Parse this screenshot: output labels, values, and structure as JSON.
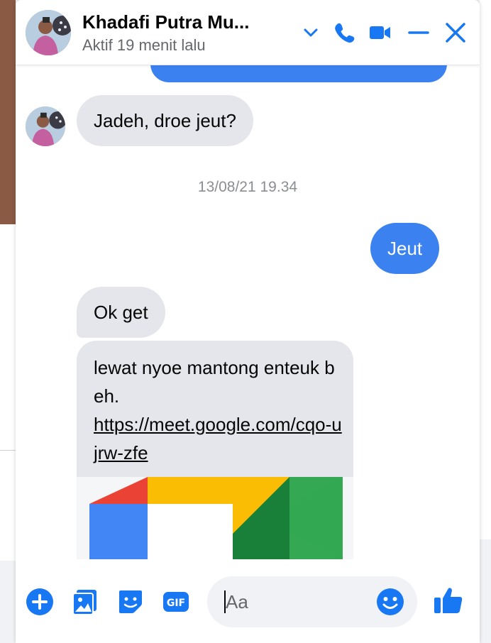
{
  "colors": {
    "accent": "#1877f2",
    "outgoing_bubble": "#3b82f0",
    "incoming_bubble": "#e4e6eb"
  },
  "header": {
    "name": "Khadafi Putra Mu...",
    "status": "Aktif 19 menit lalu",
    "icons": [
      "chevron-down-icon",
      "phone-icon",
      "video-camera-icon",
      "minimize-icon",
      "close-icon"
    ]
  },
  "messages": {
    "incoming_1": "Jadeh, droe jeut?",
    "timestamp": "13/08/21 19.34",
    "outgoing_1": "Jeut",
    "incoming_2": "Ok get",
    "incoming_3_text": "lewat nyoe mantong enteuk beh.",
    "incoming_3_link": "https://meet.google.com/cqo-ujrw-zfe",
    "link_preview_icon": "google-meet-logo"
  },
  "composer": {
    "placeholder": "Aa",
    "icons": [
      "plus-circle-icon",
      "photo-icon",
      "sticker-icon",
      "gif-icon",
      "emoji-icon",
      "thumbs-up-icon"
    ],
    "gif_label": "GIF"
  }
}
